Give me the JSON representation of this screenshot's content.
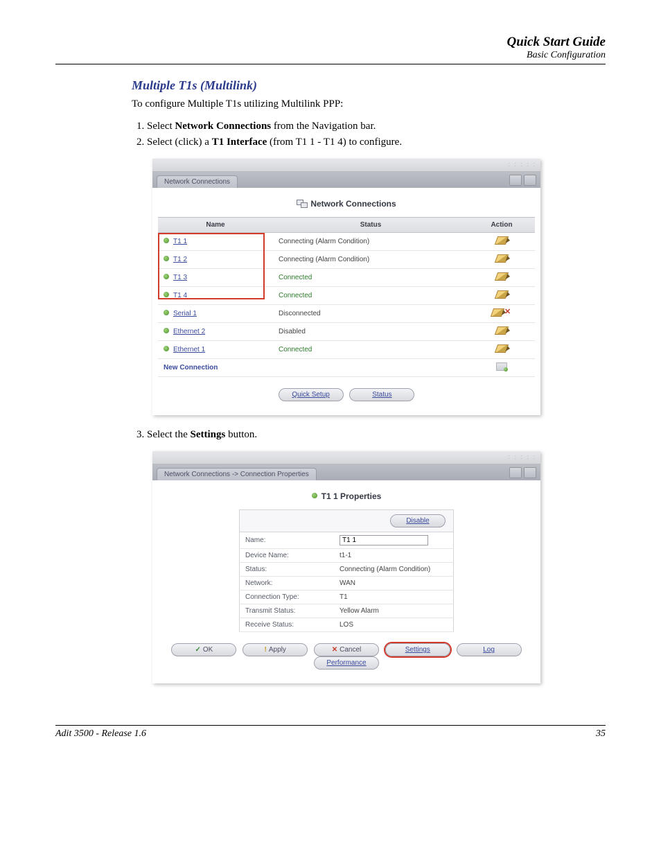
{
  "header": {
    "title": "Quick Start Guide",
    "subtitle": "Basic Configuration"
  },
  "section_title": "Multiple T1s (Multilink)",
  "intro_text": "To configure Multiple T1s utilizing Multilink PPP:",
  "step1": {
    "pre": "Select ",
    "bold": "Network Connections",
    "post": " from the Navigation bar."
  },
  "step2": {
    "pre": "Select (click) a ",
    "bold": "T1 Interface",
    "post": " (from T1 1 - T1 4) to configure."
  },
  "step3": {
    "pre": "Select the ",
    "bold": "Settings",
    "post": " button."
  },
  "shot1": {
    "tab": "Network Connections",
    "heading": "Network Connections",
    "cols": {
      "name": "Name",
      "status": "Status",
      "action": "Action"
    },
    "rows": [
      {
        "name": "T1 1",
        "status": "Connecting (Alarm Condition)",
        "green": false,
        "link": true,
        "actions": [
          "edit"
        ]
      },
      {
        "name": "T1 2",
        "status": "Connecting (Alarm Condition)",
        "green": false,
        "link": true,
        "actions": [
          "edit"
        ]
      },
      {
        "name": "T1 3",
        "status": "Connected",
        "green": true,
        "link": true,
        "actions": [
          "edit"
        ]
      },
      {
        "name": "T1 4",
        "status": "Connected",
        "green": true,
        "link": true,
        "actions": [
          "edit"
        ]
      },
      {
        "name": "Serial 1",
        "status": "Disconnected",
        "green": false,
        "link": true,
        "actions": [
          "edit",
          "del"
        ]
      },
      {
        "name": "Ethernet 2",
        "status": "Disabled",
        "green": false,
        "link": true,
        "actions": [
          "edit"
        ]
      },
      {
        "name": "Ethernet 1",
        "status": "Connected",
        "green": true,
        "link": true,
        "actions": [
          "edit"
        ]
      }
    ],
    "new_connection": "New Connection",
    "btn_quick": "Quick Setup",
    "btn_status": "Status"
  },
  "shot2": {
    "tab": "Network Connections -> Connection Properties",
    "heading": "T1 1 Properties",
    "disable_btn": "Disable",
    "fields": {
      "name_label": "Name:",
      "name_value": "T1 1",
      "device_label": "Device Name:",
      "device_value": "t1-1",
      "status_label": "Status:",
      "status_value": "Connecting (Alarm Condition)",
      "network_label": "Network:",
      "network_value": "WAN",
      "ctype_label": "Connection Type:",
      "ctype_value": "T1",
      "tx_label": "Transmit Status:",
      "tx_value": "Yellow Alarm",
      "rx_label": "Receive Status:",
      "rx_value": "LOS"
    },
    "btns": {
      "ok": "OK",
      "apply": "Apply",
      "cancel": "Cancel",
      "settings": "Settings",
      "log": "Log",
      "performance": "Performance"
    }
  },
  "footer": {
    "left": "Adit 3500  - Release 1.6",
    "right": "35"
  }
}
